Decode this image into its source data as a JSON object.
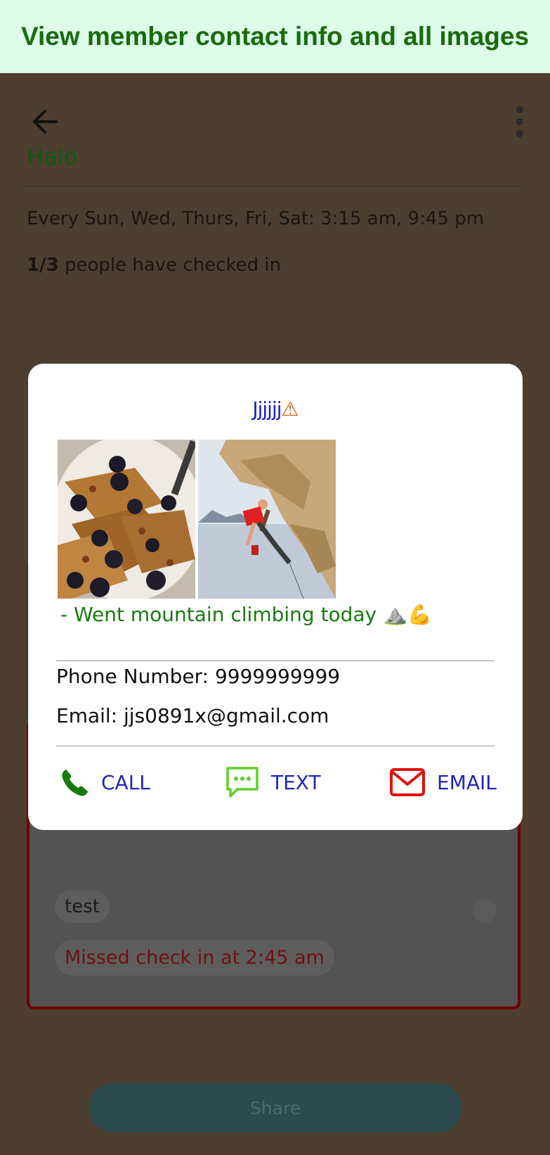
{
  "banner": {
    "text": "View member contact info and all images"
  },
  "header": {
    "title": "Halo"
  },
  "group": {
    "schedule": "Every Sun, Wed, Thurs, Fri, Sat: 3:15 am, 9:45 pm",
    "checkin_count": "1/3",
    "checkin_suffix": " people have checked in"
  },
  "member_card": {
    "name": "test",
    "status": "Missed check in at 2:45 am"
  },
  "share_label": "Share",
  "modal": {
    "name": "Jjjjjj",
    "name_emoji": "⚠",
    "caption": "- Went mountain climbing today ⛰️💪",
    "phone_line": "Phone Number: 9999999999",
    "email_line": "Email: jjs0891x@gmail.com",
    "actions": {
      "call": "CALL",
      "text": "TEXT",
      "email": "EMAIL"
    }
  },
  "colors": {
    "banner_bg": "#dcfbe9",
    "banner_text": "#1a6b0c",
    "action_text": "#1d28b8",
    "call_icon": "#177a0e",
    "text_icon": "#5fcf2b",
    "email_icon": "#e01010",
    "caption": "#177a0e"
  },
  "icons": {
    "back": "arrow-left-icon",
    "menu": "more-vert-icon",
    "call": "phone-icon",
    "text": "chat-bubble-icon",
    "email": "mail-icon"
  }
}
